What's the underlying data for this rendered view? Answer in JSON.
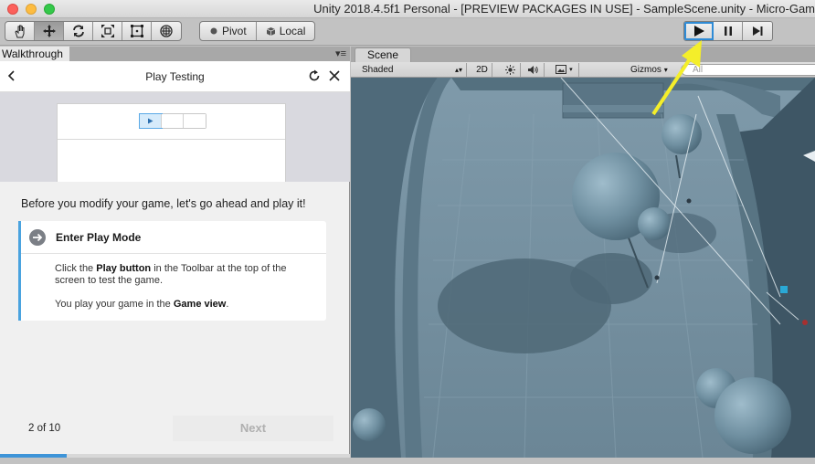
{
  "window": {
    "title": "Unity 2018.4.5f1 Personal - [PREVIEW PACKAGES IN USE] - SampleScene.unity - Micro-Gam"
  },
  "toolbar": {
    "tools": [
      "hand-icon",
      "move-icon",
      "rotate-icon",
      "scale-icon",
      "rect-icon",
      "transform-icon"
    ],
    "pivot_label": "Pivot",
    "local_label": "Local",
    "play_controls": [
      "play-icon",
      "pause-icon",
      "step-icon"
    ]
  },
  "walkthrough": {
    "tab_label": "Walkthrough",
    "header_title": "Play Testing",
    "intro": "Before you modify your game, let's go ahead and play it!",
    "step": {
      "title": "Enter Play Mode",
      "line1_pre": "Click the ",
      "line1_bold": "Play button",
      "line1_post": " in the Toolbar at the top of the screen to test the game.",
      "line2_pre": "You play your game in the ",
      "line2_bold": "Game view",
      "line2_post": "."
    },
    "page_count": "2 of 10",
    "next_label": "Next",
    "progress": 0.19
  },
  "scene": {
    "tab_label": "Scene",
    "shading_mode": "Shaded",
    "mode_2d": "2D",
    "gizmos_label": "Gizmos",
    "search_placeholder": "All"
  },
  "colors": {
    "accent": "#3e94d8",
    "annotation_arrow": "#f4ee2a"
  }
}
